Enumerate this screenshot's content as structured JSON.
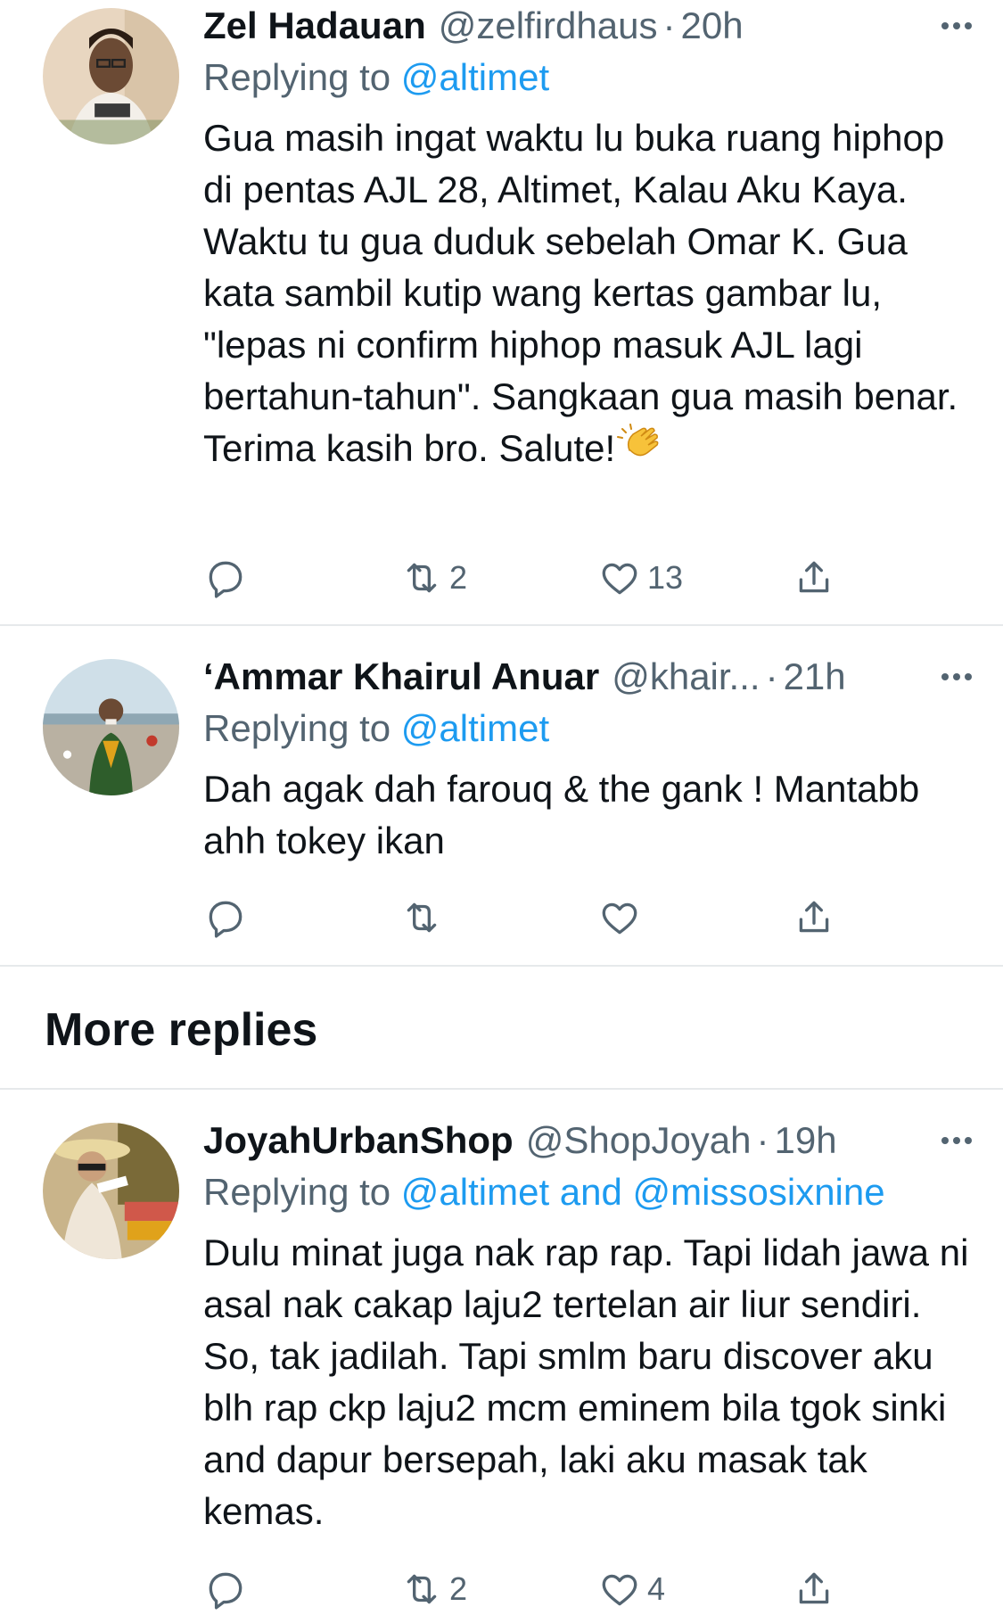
{
  "tweets": [
    {
      "name": "Zel Hadauan",
      "handle": "@zelfirdhaus",
      "time": "20h",
      "replying_prefix": "Replying to ",
      "replying_to": "@altimet",
      "text": "Gua masih ingat waktu lu buka ruang hiphop di pentas AJL 28, Altimet, Kalau Aku Kaya. Waktu tu gua duduk sebelah Omar K. Gua kata sambil kutip wang kertas gambar lu, \"lepas ni confirm hiphop masuk AJL lagi bertahun-tahun\". Sangkaan gua masih benar. Terima kasih bro. Salute!",
      "emoji": "clapping-hands",
      "retweets": "2",
      "likes": "13"
    },
    {
      "name": "‘Ammar Khairul Anuar",
      "handle": "@khair...",
      "time": "21h",
      "replying_prefix": "Replying to ",
      "replying_to": "@altimet",
      "text": "Dah agak dah farouq & the gank ! Mantabb ahh tokey ikan",
      "retweets": "",
      "likes": ""
    },
    {
      "name": "JoyahUrbanShop",
      "handle": "@ShopJoyah",
      "time": "19h",
      "replying_prefix": "Replying to ",
      "replying_to": "@altimet and @missosixnine",
      "text": "Dulu minat juga nak rap rap. Tapi lidah jawa ni asal nak cakap laju2 tertelan air liur sendiri. So, tak jadilah. Tapi smlm baru discover aku blh rap ckp laju2 mcm eminem bila tgok sinki and dapur bersepah, laki aku masak tak kemas.",
      "retweets": "2",
      "likes": "4"
    }
  ],
  "section_title": "More replies",
  "dot": "·",
  "colors": {
    "link": "#1d9bf0",
    "secondary": "#536471",
    "divider": "#e6e9eb"
  }
}
